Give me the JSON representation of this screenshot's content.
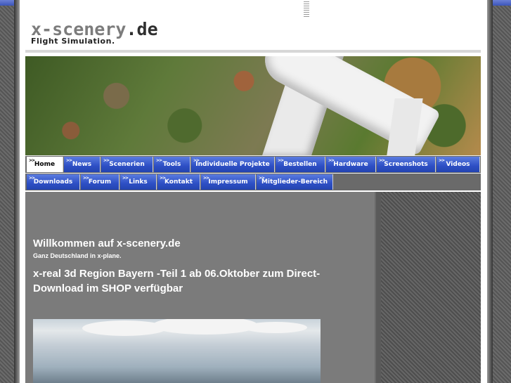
{
  "logo": {
    "title_prefix": "x-scenery",
    "title_suffix": ".de",
    "subtitle": "Flight Simulation."
  },
  "nav": {
    "row1": [
      {
        "label": "Home",
        "active": true
      },
      {
        "label": "News"
      },
      {
        "label": "Scenerien"
      },
      {
        "label": "Tools"
      },
      {
        "label": "Individuelle Projekte"
      },
      {
        "label": "Bestellen"
      },
      {
        "label": "Hardware"
      },
      {
        "label": "Screenshots"
      },
      {
        "label": "Videos"
      }
    ],
    "row2": [
      {
        "label": "Downloads"
      },
      {
        "label": "Forum"
      },
      {
        "label": "Links"
      },
      {
        "label": "Kontakt"
      },
      {
        "label": "Impressum"
      },
      {
        "label": "Mitglieder-Bereich"
      }
    ]
  },
  "content": {
    "welcome": "Willkommen auf x-scenery.de",
    "tagline": "Ganz Deutschland in x-plane.",
    "headline": "x-real 3d Region Bayern -Teil 1 ab 06.Oktober zum Direct-Download im SHOP verfügbar"
  },
  "colors": {
    "nav_blue": "#2d4fc4",
    "content_gray": "#7b7b7b",
    "accent_strip": "#4a63c6"
  }
}
